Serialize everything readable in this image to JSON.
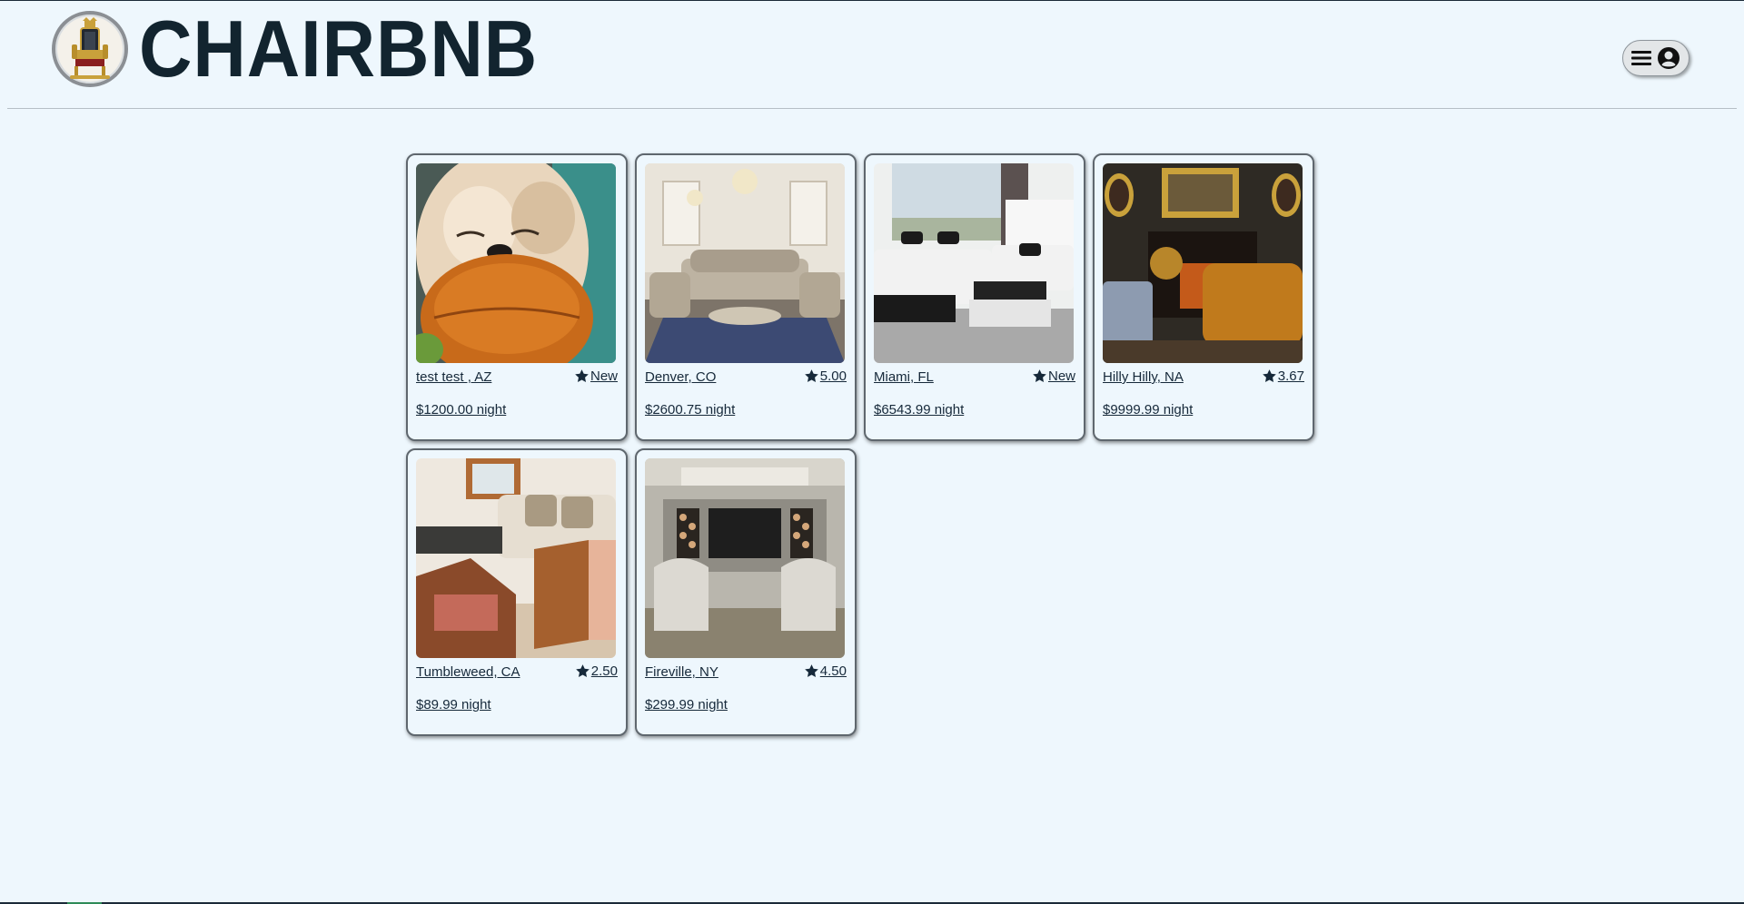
{
  "brand": {
    "name": "CHAIRBNB",
    "logo_icon": "throne-chair-icon"
  },
  "header": {
    "menu_icon": "hamburger-menu-icon",
    "profile_icon": "user-circle-icon"
  },
  "listings": [
    {
      "location": "test test , AZ",
      "rating": "New",
      "price": "$1200.00 night",
      "image": "dog-with-toy-photo"
    },
    {
      "location": "Denver, CO",
      "rating": "5.00",
      "price": "$2600.75 night",
      "image": "ornate-living-room-photo"
    },
    {
      "location": "Miami, FL",
      "rating": "New",
      "price": "$6543.99 night",
      "image": "white-sectional-sofa-photo"
    },
    {
      "location": "Hilly Hilly, NA",
      "rating": "3.67",
      "price": "$9999.99 night",
      "image": "victorian-parlor-photo"
    },
    {
      "location": "Tumbleweed, CA",
      "rating": "2.50",
      "price": "$89.99 night",
      "image": "cane-chairs-living-room-photo"
    },
    {
      "location": "Fireville, NY",
      "rating": "4.50",
      "price": "$299.99 night",
      "image": "fireplace-armchairs-photo"
    }
  ],
  "colors": {
    "background": "#eef7fd",
    "text": "#16293a",
    "card_border": "#5f676e"
  }
}
